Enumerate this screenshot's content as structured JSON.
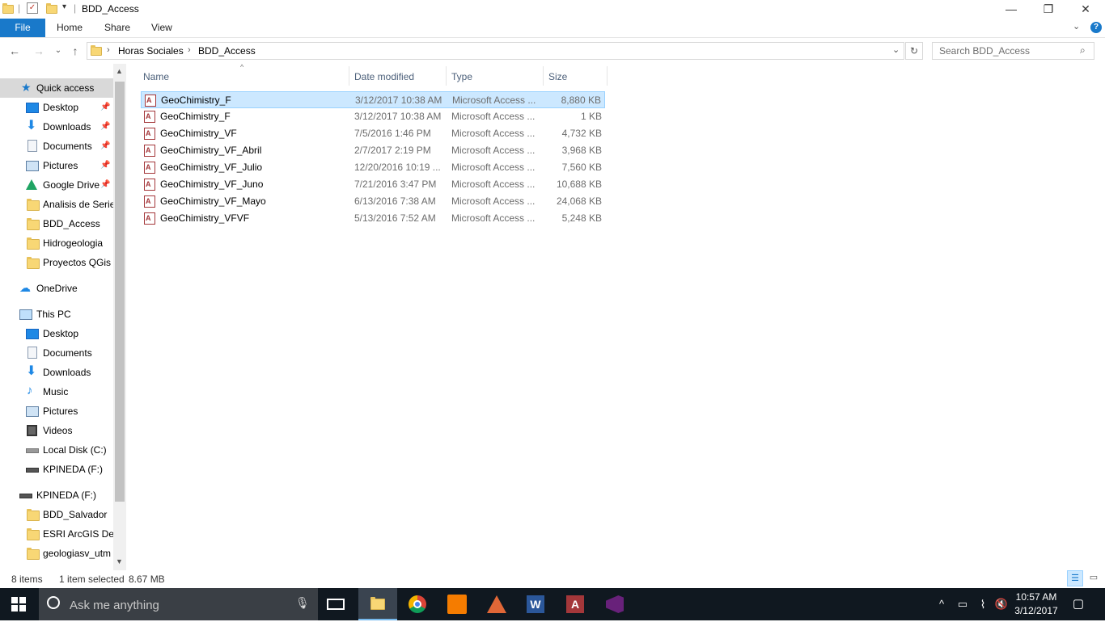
{
  "window": {
    "title": "BDD_Access",
    "controls": {
      "minimize": "—",
      "restore": "❐",
      "close": "✕"
    }
  },
  "ribbon": {
    "tabs": [
      "File",
      "Home",
      "Share",
      "View"
    ],
    "collapse_icon": "chevron-down-icon",
    "help_icon": "help-icon"
  },
  "address": {
    "path": [
      "Horas Sociales",
      "BDD_Access"
    ],
    "search_placeholder": "Search BDD_Access"
  },
  "navpane": {
    "quick_access": {
      "label": "Quick access",
      "items": [
        {
          "label": "Desktop",
          "icon": "desktop-icon",
          "pinned": true
        },
        {
          "label": "Downloads",
          "icon": "download-icon",
          "pinned": true
        },
        {
          "label": "Documents",
          "icon": "documents-icon",
          "pinned": true
        },
        {
          "label": "Pictures",
          "icon": "pictures-icon",
          "pinned": true
        },
        {
          "label": "Google Drive",
          "icon": "google-drive-icon",
          "pinned": true
        },
        {
          "label": "Analisis de Series",
          "icon": "folder-check-icon",
          "pinned": false
        },
        {
          "label": "BDD_Access",
          "icon": "folder-icon",
          "pinned": false
        },
        {
          "label": "Hidrogeologia",
          "icon": "folder-icon",
          "pinned": false
        },
        {
          "label": "Proyectos QGis",
          "icon": "folder-icon",
          "pinned": false
        }
      ]
    },
    "onedrive": "OneDrive",
    "this_pc": {
      "label": "This PC",
      "items": [
        {
          "label": "Desktop",
          "icon": "desktop-icon"
        },
        {
          "label": "Documents",
          "icon": "documents-icon"
        },
        {
          "label": "Downloads",
          "icon": "download-icon"
        },
        {
          "label": "Music",
          "icon": "music-icon"
        },
        {
          "label": "Pictures",
          "icon": "pictures-icon"
        },
        {
          "label": "Videos",
          "icon": "videos-icon"
        },
        {
          "label": "Local Disk (C:)",
          "icon": "disk-icon"
        },
        {
          "label": "KPINEDA (F:)",
          "icon": "usb-drive-icon"
        }
      ]
    },
    "drive": {
      "label": "KPINEDA (F:)",
      "items": [
        {
          "label": "BDD_Salvador",
          "icon": "folder-icon"
        },
        {
          "label": "ESRI ArcGIS Desktop",
          "icon": "folder-icon"
        },
        {
          "label": "geologiasv_utm",
          "icon": "folder-icon"
        }
      ]
    }
  },
  "filelist": {
    "columns": [
      "Name",
      "Date modified",
      "Type",
      "Size"
    ],
    "rows": [
      {
        "name": "GeoChimistry_F",
        "date": "3/12/2017 10:38 AM",
        "type": "Microsoft Access ...",
        "size": "8,880 KB",
        "selected": true
      },
      {
        "name": "GeoChimistry_F",
        "date": "3/12/2017 10:38 AM",
        "type": "Microsoft Access ...",
        "size": "1 KB",
        "selected": false
      },
      {
        "name": "GeoChimistry_VF",
        "date": "7/5/2016 1:46 PM",
        "type": "Microsoft Access ...",
        "size": "4,732 KB",
        "selected": false
      },
      {
        "name": "GeoChimistry_VF_Abril",
        "date": "2/7/2017 2:19 PM",
        "type": "Microsoft Access ...",
        "size": "3,968 KB",
        "selected": false
      },
      {
        "name": "GeoChimistry_VF_Julio",
        "date": "12/20/2016 10:19 ...",
        "type": "Microsoft Access ...",
        "size": "7,560 KB",
        "selected": false
      },
      {
        "name": "GeoChimistry_VF_Juno",
        "date": "7/21/2016 3:47 PM",
        "type": "Microsoft Access ...",
        "size": "10,688 KB",
        "selected": false
      },
      {
        "name": "GeoChimistry_VF_Mayo",
        "date": "6/13/2016 7:38 AM",
        "type": "Microsoft Access ...",
        "size": "24,068 KB",
        "selected": false
      },
      {
        "name": "GeoChimistry_VFVF",
        "date": "5/13/2016 7:52 AM",
        "type": "Microsoft Access ...",
        "size": "5,248 KB",
        "selected": false
      }
    ]
  },
  "status": {
    "count": "8 items",
    "selection": "1 item selected",
    "size": "8.67 MB"
  },
  "taskbar": {
    "search_placeholder": "Ask me anything",
    "apps": [
      "file-explorer-icon",
      "chrome-icon",
      "pdf-editor-icon",
      "matlab-icon",
      "word-icon",
      "access-icon",
      "visual-studio-icon"
    ],
    "time": "10:57 AM",
    "date": "3/12/2017"
  },
  "colors": {
    "accent": "#1979ca",
    "selection_bg": "#cce8ff",
    "taskbar_bg": "#101820",
    "access_red": "#a4373a"
  }
}
